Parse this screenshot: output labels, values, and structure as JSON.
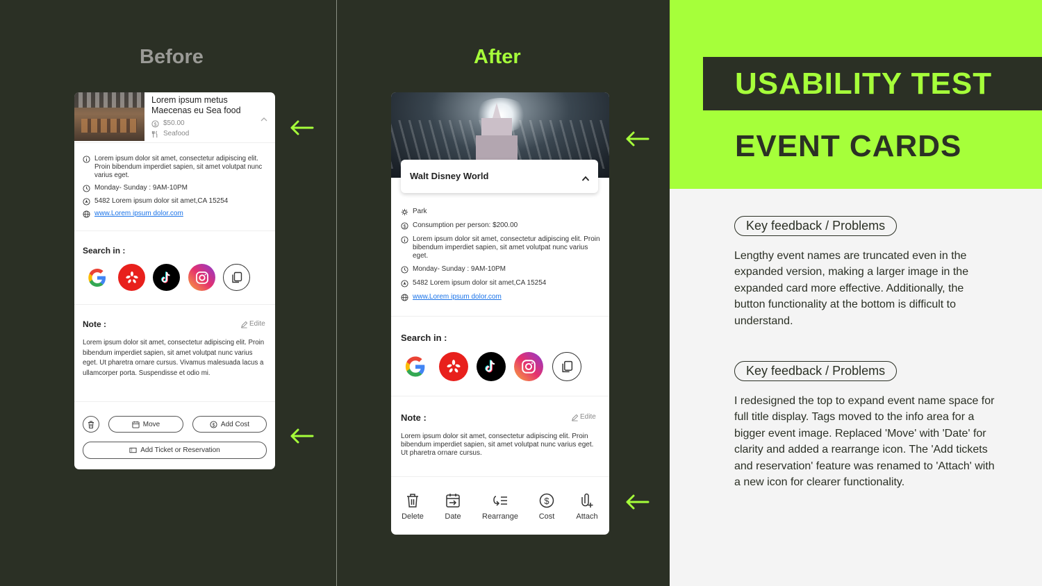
{
  "before": {
    "heading": "Before",
    "card": {
      "name": "Lorem ipsum metus Maecenas eu Sea food",
      "price": "$50.00",
      "tag": "Seafood",
      "description": "Lorem ipsum dolor sit amet, consectetur adipiscing elit. Proin bibendum imperdiet sapien, sit amet volutpat nunc varius eget.",
      "hours": "Monday- Sunday : 9AM-10PM",
      "address": "5482 Lorem ipsum dolor sit amet,CA  15254",
      "website": "www.Lorem ipsum dolor.com",
      "search_label": "Search in :",
      "note_label": "Note :",
      "edit_label": "Edite",
      "note_text": "Lorem ipsum dolor sit amet, consectetur adipiscing elit. Proin bibendum imperdiet sapien, sit amet volutpat nunc varius eget. Ut pharetra ornare cursus. Vivamus malesuada lacus a ullamcorper porta. Suspendisse et odio mi.",
      "move_label": "Move",
      "add_cost_label": "Add Cost",
      "ticket_label": "Add Ticket or Reservation"
    }
  },
  "after": {
    "heading": "After",
    "card": {
      "name": "Walt Disney World",
      "category": "Park",
      "consumption": "Consumption per person: $200.00",
      "description": "Lorem ipsum dolor sit amet, consectetur adipiscing elit. Proin bibendum imperdiet sapien, sit amet volutpat nunc varius eget.",
      "hours": "Monday- Sunday : 9AM-10PM",
      "address": "5482 Lorem ipsum dolor sit amet,CA  15254",
      "website": "www.Lorem ipsum dolor.com",
      "search_label": "Search in :",
      "note_label": "Note :",
      "edit_label": "Edite",
      "note_text": "Lorem ipsum dolor sit amet, consectetur adipiscing elit. Proin bibendum imperdiet sapien, sit amet volutpat nunc varius eget. Ut pharetra ornare cursus.",
      "actions": [
        "Delete",
        "Date",
        "Rearrange",
        "Cost",
        "Attach"
      ]
    }
  },
  "summary": {
    "title_line1": "USABILITY TEST",
    "title_line2": "EVENT CARDS",
    "feedback1_label": "Key feedback / Problems",
    "feedback1_text": "Lengthy event names are truncated even in the expanded version, making a larger image in the expanded card more effective. Additionally, the button functionality at the bottom is difficult to understand.",
    "feedback2_label": "Key feedback / Problems",
    "feedback2_text": "I redesigned the top to expand event name space for full title display. Tags moved to the info area for a bigger event image. Replaced 'Move' with 'Date' for clarity and added a rearrange icon. The 'Add tickets and reservation' feature was renamed to 'Attach' with a new icon for clearer functionality."
  },
  "colors": {
    "accent": "#a6ff3a",
    "dark": "#2b3025",
    "before_heading": "#9a9a96",
    "link": "#1a73e8"
  },
  "icons": [
    "arrow-left-icon",
    "google-icon",
    "yelp-icon",
    "tiktok-icon",
    "instagram-icon",
    "copy-icon",
    "info-icon",
    "clock-icon",
    "location-icon",
    "globe-icon",
    "dollar-icon",
    "pencil-icon",
    "trash-icon",
    "calendar-icon",
    "rearrange-icon",
    "attach-icon",
    "ticket-icon",
    "chevron-up-icon"
  ]
}
